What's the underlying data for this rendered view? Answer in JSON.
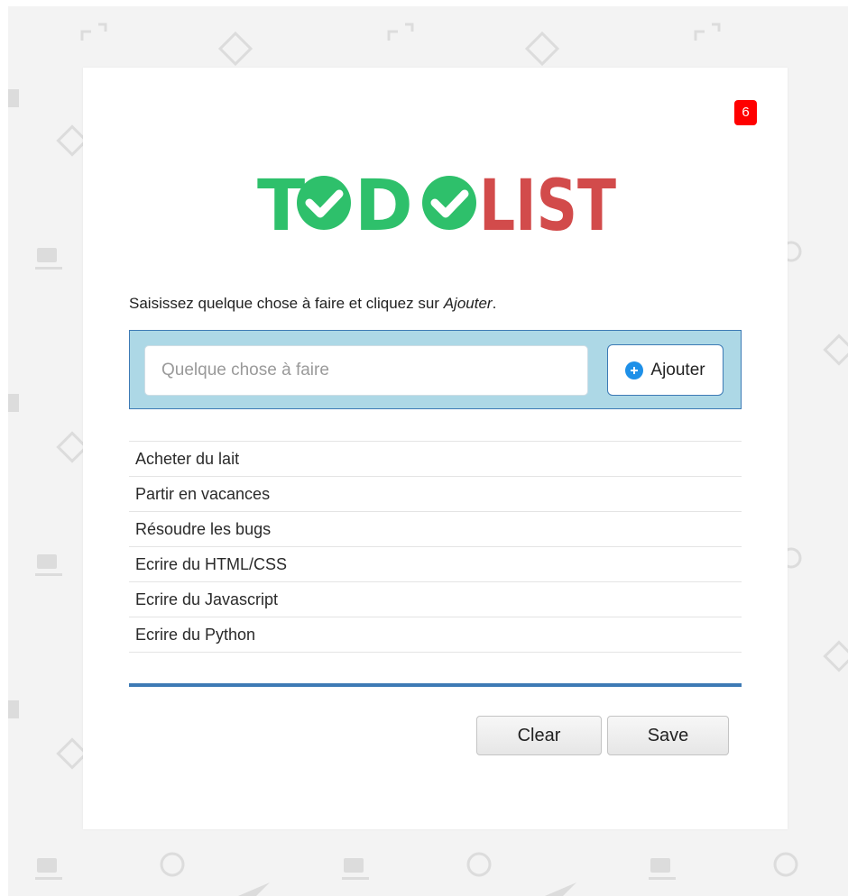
{
  "badge": {
    "count": "6"
  },
  "logo": {
    "part1": "TODO",
    "part2": "LIST"
  },
  "instruction": {
    "text": "Saisissez quelque chose à faire et cliquez sur ",
    "emphasis": "Ajouter",
    "suffix": "."
  },
  "input": {
    "placeholder": "Quelque chose à faire",
    "value": ""
  },
  "add_button": {
    "label": "Ajouter",
    "icon": "plus-circle-icon"
  },
  "todos": [
    {
      "label": "Acheter du lait"
    },
    {
      "label": "Partir en vacances"
    },
    {
      "label": "Résoudre les bugs"
    },
    {
      "label": "Ecrire du HTML/CSS"
    },
    {
      "label": "Ecrire du Javascript"
    },
    {
      "label": "Ecrire du Python"
    }
  ],
  "actions": {
    "clear_label": "Clear",
    "save_label": "Save"
  },
  "colors": {
    "logo_green": "#2ec06b",
    "logo_red": "#d24b4b",
    "badge_red": "#ff0000",
    "panel_bg": "#add8e6",
    "accent_blue": "#3d7ab5",
    "plus_blue": "#1e90e8"
  }
}
